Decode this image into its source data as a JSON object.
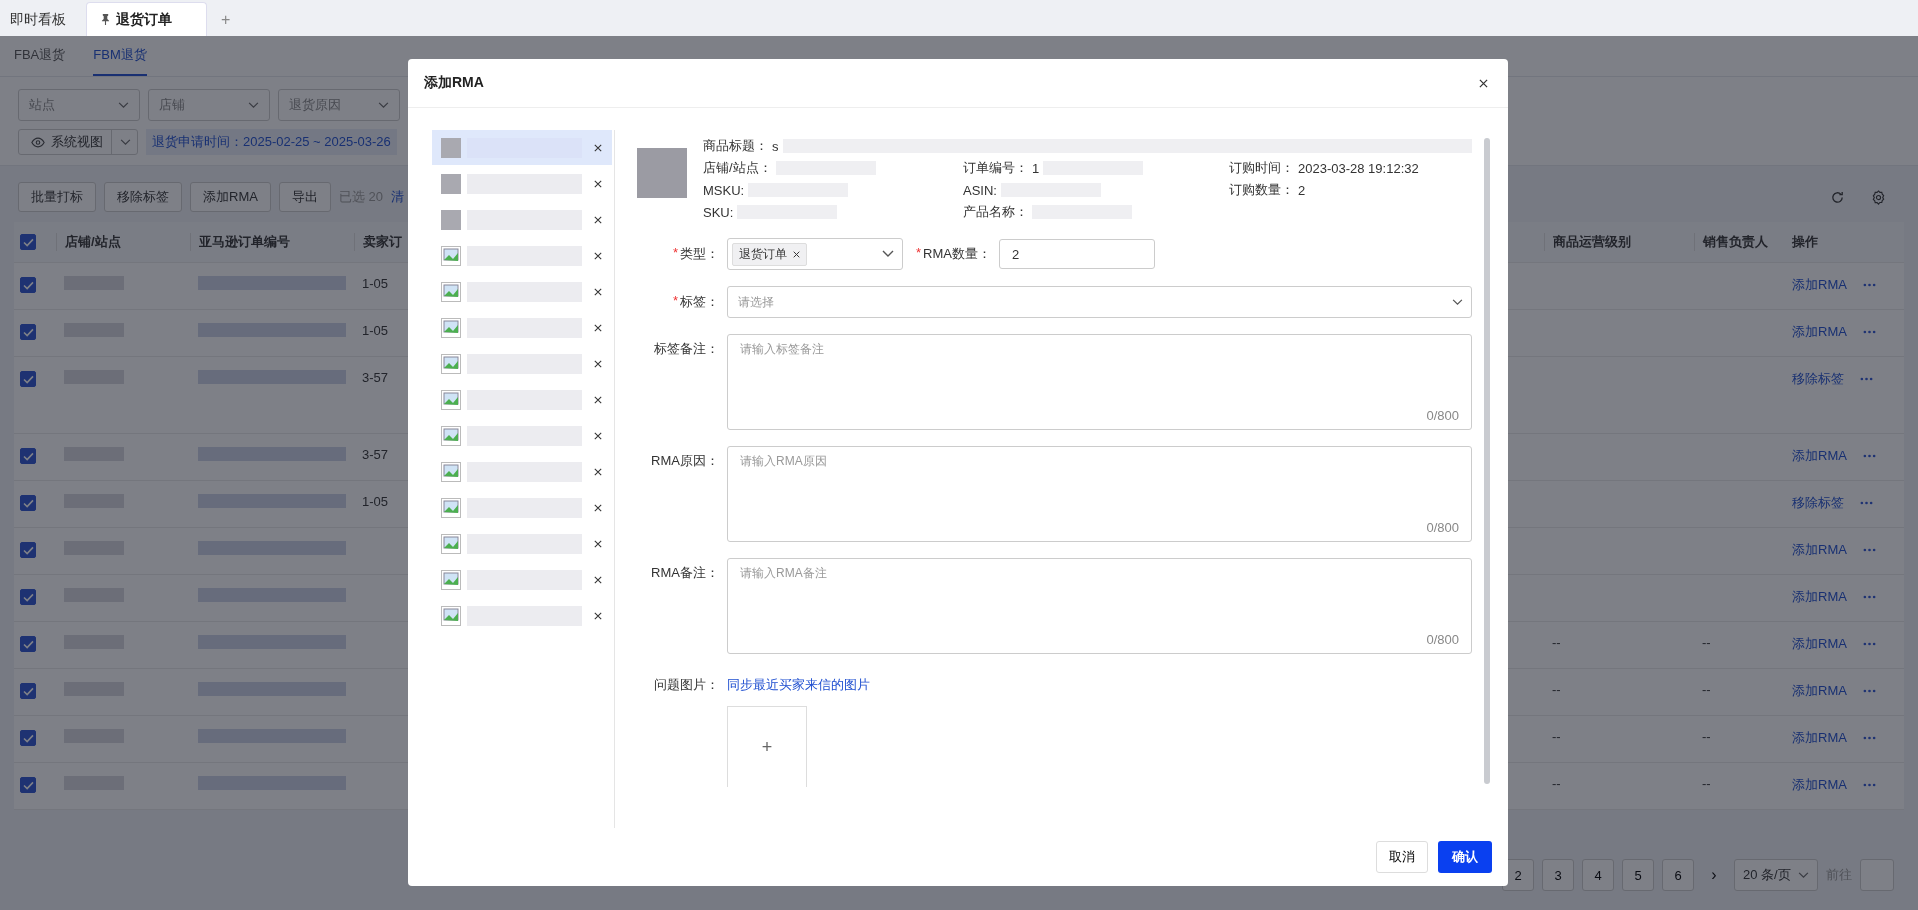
{
  "top_tabs": [
    {
      "label": "即时看板",
      "selected": false,
      "pinned": false
    },
    {
      "label": "退货订单",
      "selected": true,
      "pinned": true
    }
  ],
  "add_tab": "+",
  "sub_tabs": [
    {
      "label": "FBA退货",
      "selected": false
    },
    {
      "label": "FBM退货",
      "selected": true
    }
  ],
  "filters": [
    {
      "placeholder": "站点"
    },
    {
      "placeholder": "店铺"
    },
    {
      "placeholder": "退货原因"
    }
  ],
  "view_select": "系统视图",
  "date_filter": "退货申请时间：2025-02-25 ~ 2025-03-26",
  "toolbar": {
    "buttons": [
      "批量打标",
      "移除标签",
      "添加RMA",
      "导出"
    ],
    "selected_count": "已选 20",
    "clear_link": "清"
  },
  "table": {
    "header_checked": true,
    "columns": [
      "店铺/站点",
      "亚马逊订单编号",
      "卖家订",
      "商品运营级别",
      "销售负责人",
      "操作"
    ],
    "rows": [
      {
        "checked": true,
        "seller_order": "1-05",
        "ops_level": "",
        "sales_owner": "",
        "action": "添加RMA",
        "tall": false
      },
      {
        "checked": true,
        "seller_order": "1-05",
        "ops_level": "",
        "sales_owner": "",
        "action": "添加RMA",
        "tall": false
      },
      {
        "checked": true,
        "seller_order": "3-57",
        "ops_level": "",
        "sales_owner": "",
        "action": "移除标签",
        "tall": true
      },
      {
        "checked": true,
        "seller_order": "3-57",
        "ops_level": "",
        "sales_owner": "",
        "action": "添加RMA",
        "tall": false
      },
      {
        "checked": true,
        "seller_order": "1-05",
        "ops_level": "",
        "sales_owner": "",
        "action": "移除标签",
        "tall": false
      },
      {
        "checked": true,
        "seller_order": "",
        "ops_level": "",
        "sales_owner": "",
        "action": "添加RMA",
        "tall": false
      },
      {
        "checked": true,
        "seller_order": "",
        "ops_level": "",
        "sales_owner": "",
        "action": "添加RMA",
        "tall": false
      },
      {
        "checked": true,
        "seller_order": "",
        "ops_level": "--",
        "sales_owner": "--",
        "action": "添加RMA",
        "tall": false
      },
      {
        "checked": true,
        "seller_order": "",
        "ops_level": "--",
        "sales_owner": "--",
        "action": "添加RMA",
        "tall": false
      },
      {
        "checked": true,
        "seller_order": "",
        "ops_level": "--",
        "sales_owner": "--",
        "action": "添加RMA",
        "tall": false
      },
      {
        "checked": true,
        "seller_order": "",
        "ops_level": "--",
        "sales_owner": "--",
        "action": "添加RMA",
        "tall": false
      }
    ]
  },
  "pagination": {
    "pages": [
      "2",
      "3",
      "4",
      "5",
      "6"
    ],
    "next": "›",
    "page_size": "20 条/页",
    "goto": "前往"
  },
  "modal": {
    "title": "添加RMA",
    "items": [
      {
        "kind": "thumb",
        "selected": true
      },
      {
        "kind": "thumb",
        "selected": false
      },
      {
        "kind": "thumb",
        "selected": false
      },
      {
        "kind": "broken",
        "selected": false
      },
      {
        "kind": "broken",
        "selected": false
      },
      {
        "kind": "broken",
        "selected": false
      },
      {
        "kind": "broken",
        "selected": false
      },
      {
        "kind": "broken",
        "selected": false
      },
      {
        "kind": "broken",
        "selected": false
      },
      {
        "kind": "broken",
        "selected": false
      },
      {
        "kind": "broken",
        "selected": false
      },
      {
        "kind": "broken",
        "selected": false
      },
      {
        "kind": "broken",
        "selected": false
      },
      {
        "kind": "broken",
        "selected": false
      }
    ],
    "info": [
      {
        "label": "商品标题：",
        "value": "s",
        "wide": true
      },
      {
        "label": "店铺/站点："
      },
      {
        "label": "订单编号：",
        "value": "1"
      },
      {
        "label": "订购时间：",
        "value": "2023-03-28 19:12:32"
      },
      {
        "label": "MSKU:"
      },
      {
        "label": "ASIN:"
      },
      {
        "label": "订购数量：",
        "value": "2"
      },
      {
        "label": "SKU:"
      },
      {
        "label": "产品名称："
      }
    ],
    "type_field": {
      "required_mark": "*",
      "label": "类型：",
      "tag": "退货订单"
    },
    "qty_field": {
      "required_mark": "*",
      "label": "RMA数量：",
      "value": "2"
    },
    "tag_field": {
      "required_mark": "*",
      "label": "标签：",
      "placeholder": "请选择"
    },
    "textareas": [
      {
        "label": "标签备注：",
        "placeholder": "请输入标签备注",
        "counter": "0/800"
      },
      {
        "label": "RMA原因：",
        "placeholder": "请输入RMA原因",
        "counter": "0/800"
      },
      {
        "label": "RMA备注：",
        "placeholder": "请输入RMA备注",
        "counter": "0/800"
      }
    ],
    "images": {
      "label": "问题图片：",
      "sync_link": "同步最近买家来信的图片",
      "upload": "+"
    },
    "cancel": "取消",
    "confirm": "确认"
  }
}
